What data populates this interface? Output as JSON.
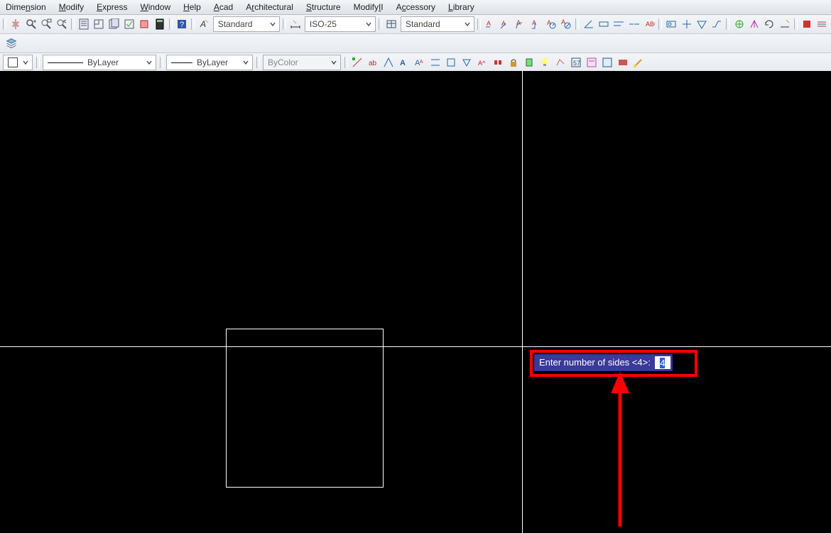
{
  "menu": {
    "items": [
      {
        "label": "Dime<u>n</u>sion"
      },
      {
        "label": "<u>M</u>odify"
      },
      {
        "label": "<u>E</u>xpress"
      },
      {
        "label": "<u>W</u>indow"
      },
      {
        "label": "<u>H</u>elp"
      },
      {
        "label": "<u>A</u>cad"
      },
      {
        "label": "A<u>r</u>chitectural"
      },
      {
        "label": "<u>S</u>tructure"
      },
      {
        "label": "Modify<u>I</u>I"
      },
      {
        "label": "A<u>c</u>cessory"
      },
      {
        "label": "<u>L</u>ibrary"
      }
    ]
  },
  "row1": {
    "textstyle": "Standard",
    "dimstyle": "ISO-25",
    "tablestyle": "Standard"
  },
  "row2": {
    "linetype": "ByLayer",
    "lineweight": "ByLayer",
    "plotstyle": "ByColor"
  },
  "prompt": {
    "label": "Enter number of sides <4>:",
    "value": "4"
  }
}
